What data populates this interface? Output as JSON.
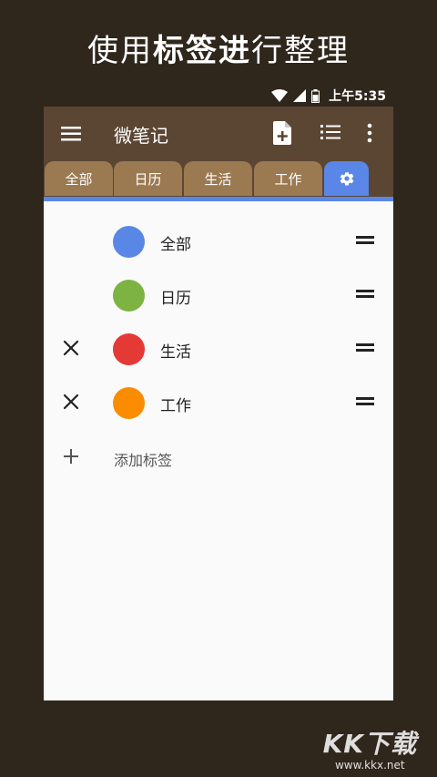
{
  "headline": {
    "part1": "使用",
    "bold": "标签进",
    "part2": "行整理"
  },
  "statusbar": {
    "time": "上午5:35"
  },
  "appbar": {
    "title": "微笔记"
  },
  "tabs": [
    {
      "label": "全部"
    },
    {
      "label": "日历"
    },
    {
      "label": "生活"
    },
    {
      "label": "工作"
    },
    {
      "label": "",
      "icon": "gear-icon",
      "active": true
    }
  ],
  "labels": [
    {
      "name": "全部",
      "color": "#5887e6",
      "deletable": false
    },
    {
      "name": "日历",
      "color": "#7cb342",
      "deletable": false
    },
    {
      "name": "生活",
      "color": "#e53935",
      "deletable": true
    },
    {
      "name": "工作",
      "color": "#fb8c00",
      "deletable": true
    }
  ],
  "add_label": "添加标签",
  "watermark": {
    "big": "KK下载",
    "small": "www.kkx.net"
  }
}
